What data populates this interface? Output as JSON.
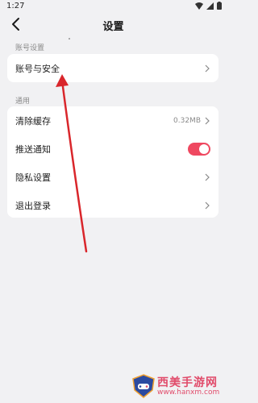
{
  "status_bar": {
    "time": "1:27",
    "icons": [
      "wifi-icon",
      "signal-icon",
      "battery-icon"
    ]
  },
  "header": {
    "title": "设置",
    "back_icon": "chevron-left-icon"
  },
  "sections": {
    "account": {
      "label": "账号设置",
      "items": [
        {
          "label": "账号与安全",
          "value": "",
          "control": "chevron"
        }
      ]
    },
    "general": {
      "label": "通用",
      "items": [
        {
          "label": "清除缓存",
          "value": "0.32MB",
          "control": "chevron"
        },
        {
          "label": "推送通知",
          "value": "",
          "control": "toggle",
          "on": true
        },
        {
          "label": "隐私设置",
          "value": "",
          "control": "chevron"
        },
        {
          "label": "退出登录",
          "value": "",
          "control": "chevron"
        }
      ]
    }
  },
  "colors": {
    "toggle_on": "#ef4860",
    "background": "#f1f1f3",
    "card": "#ffffff",
    "annotation_arrow": "#d9262b",
    "watermark": "#e14b6a"
  },
  "watermark": {
    "title": "西美手游网",
    "url": "www.hanxm.com",
    "logo_icon": "shield-gamepad-logo"
  }
}
